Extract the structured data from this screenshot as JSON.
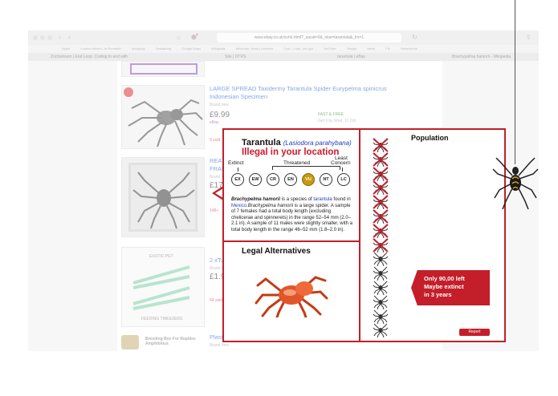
{
  "browser": {
    "url": "www.ebay.co.uk/sch/i.html?_sacat=0&_nkw=tarantula&_frs=1",
    "bookmarks": [
      "Apple",
      "London Museu...le Romantic",
      "shopping",
      "Gestaltung",
      "Google Maps",
      "Wikipedia",
      "Welcome, Hans | LinkedIn",
      "Cryo - Look...ehr gut",
      "YouTube",
      "Design",
      "News",
      "Fix",
      "Reisewords"
    ],
    "tabs": [
      "Zochwissen | End Loop: Coding to end with",
      "Site | DTRS",
      "tarantula | eBay",
      "Brachypelma hamorii - Wikipedia"
    ],
    "notification_count": "4"
  },
  "listings": [
    {
      "title": "LARGE SPREAD Taxidermy Tarantula Spider Eurypelma spinicrus Indonesian Specimen",
      "condition": "Brand new",
      "price": "£9.99",
      "shipping_label": "FAST & FREE",
      "delivery": "Get it by Wed, 11 Oct",
      "sold": "9 sold"
    },
    {
      "title_partial": "REAL FRAM",
      "condition": "Brand new",
      "price_partial": "£17",
      "watch_partial": "148+"
    },
    {
      "title_partial": "2 xTw",
      "condition": "Brand new",
      "price_partial": "£1.9",
      "sold_partial": "64 sold",
      "image_label_top": "EXOTIC PET",
      "image_label_bottom": "FEEDING TWEEZERS"
    },
    {
      "title_partial": "Plast",
      "condition": "Brand new",
      "image_label": "Breeding Box For Reptiles Amphibious"
    }
  ],
  "overlay": {
    "name": "Tarantula",
    "scientific_name": "(Lasiodora parahybana)",
    "warning": "Illegal in your location",
    "labels": {
      "extinct": "Extinct",
      "threatened": "Threatened",
      "least_concern_1": "Least",
      "least_concern_2": "Concern"
    },
    "categories": [
      "EX",
      "EW",
      "CR",
      "EN",
      "VU",
      "NT",
      "LC"
    ],
    "active_category": "VU",
    "description": {
      "species": "Brachypelma hamorii",
      "text1": " is a species of ",
      "link1": "tarantula",
      "text2": " found in ",
      "link2": "Mexico",
      "text3": ".",
      "detail_species": "Brachypelma hamorii",
      "detail": " is a large spider. A sample of 7 females had a total body length (excluding chelicerae and spinnerets) in the range 52–54 mm (2.0–2.1 in). A sample of 11 males were slightly smaller, with a total body length in the range 46–52 mm (1.8–2.0 in)."
    },
    "legal_title": "Legal Alternatives",
    "population_title": "Population",
    "callout": [
      "Only 90,00 left",
      "Maybe extinct",
      "in 3 years"
    ],
    "report_label": "Report",
    "population": {
      "total_icons": 14,
      "crossed_out": 8
    }
  },
  "colors": {
    "accent": "#c41e2a",
    "active_status": "#c8980f",
    "link": "#1f3fbf"
  }
}
